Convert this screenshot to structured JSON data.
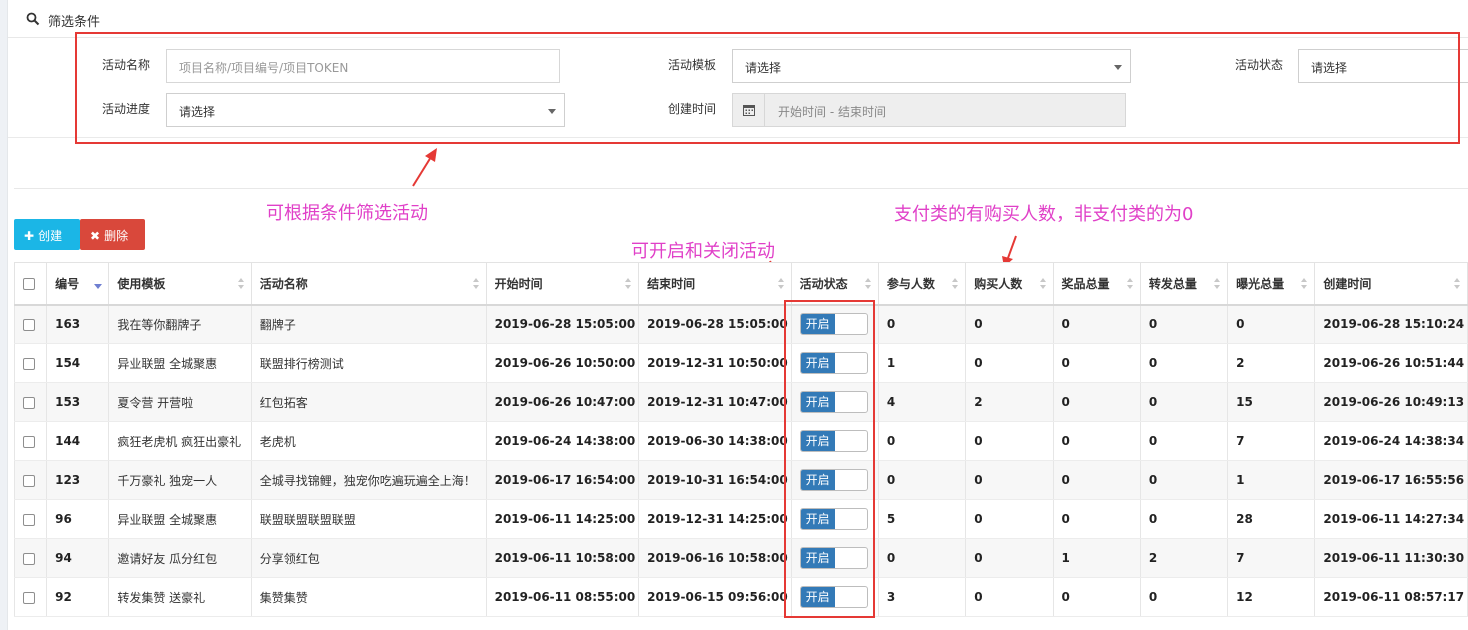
{
  "filter": {
    "title": "筛选条件",
    "name_label": "活动名称",
    "name_placeholder": "项目名称/项目编号/项目TOKEN",
    "template_label": "活动模板",
    "template_value": "请选择",
    "status_label": "活动状态",
    "status_value": "请选择",
    "progress_label": "活动进度",
    "progress_value": "请选择",
    "created_label": "创建时间",
    "created_placeholder": "开始时间 - 结束时间"
  },
  "annotations": {
    "filter_note": "可根据条件筛选活动",
    "toggle_note": "可开启和关闭活动",
    "buyers_note": "支付类的有购买人数，非支付类的为0"
  },
  "toolbar": {
    "create_label": "创建",
    "delete_label": "删除"
  },
  "table": {
    "columns": [
      "编号",
      "使用模板",
      "活动名称",
      "开始时间",
      "结束时间",
      "活动状态",
      "参与人数",
      "购买人数",
      "奖品总量",
      "转发总量",
      "曝光总量",
      "创建时间"
    ],
    "rows": [
      {
        "id": "163",
        "template": "我在等你翻牌子",
        "name": "翻牌子",
        "start": "2019-06-28 15:05:00",
        "end": "2019-06-28 15:05:00",
        "status": "开启",
        "participants": "0",
        "buyers": "0",
        "prizes": "0",
        "shares": "0",
        "exposure": "0",
        "created": "2019-06-28 15:10:24"
      },
      {
        "id": "154",
        "template": "异业联盟 全城聚惠",
        "name": "联盟排行榜测试",
        "start": "2019-06-26 10:50:00",
        "end": "2019-12-31 10:50:00",
        "status": "开启",
        "participants": "1",
        "buyers": "0",
        "prizes": "0",
        "shares": "0",
        "exposure": "2",
        "created": "2019-06-26 10:51:44"
      },
      {
        "id": "153",
        "template": "夏令营 开营啦",
        "name": "红包拓客",
        "start": "2019-06-26 10:47:00",
        "end": "2019-12-31 10:47:00",
        "status": "开启",
        "participants": "4",
        "buyers": "2",
        "prizes": "0",
        "shares": "0",
        "exposure": "15",
        "created": "2019-06-26 10:49:13"
      },
      {
        "id": "144",
        "template": "疯狂老虎机 疯狂出豪礼",
        "name": "老虎机",
        "start": "2019-06-24 14:38:00",
        "end": "2019-06-30 14:38:00",
        "status": "开启",
        "participants": "0",
        "buyers": "0",
        "prizes": "0",
        "shares": "0",
        "exposure": "7",
        "created": "2019-06-24 14:38:34"
      },
      {
        "id": "123",
        "template": "千万豪礼 独宠一人",
        "name": "全城寻找锦鲤，独宠你吃遍玩遍全上海！",
        "start": "2019-06-17 16:54:00",
        "end": "2019-10-31 16:54:00",
        "status": "开启",
        "participants": "0",
        "buyers": "0",
        "prizes": "0",
        "shares": "0",
        "exposure": "1",
        "created": "2019-06-17 16:55:56"
      },
      {
        "id": "96",
        "template": "异业联盟 全城聚惠",
        "name": "联盟联盟联盟联盟",
        "start": "2019-06-11 14:25:00",
        "end": "2019-12-31 14:25:00",
        "status": "开启",
        "participants": "5",
        "buyers": "0",
        "prizes": "0",
        "shares": "0",
        "exposure": "28",
        "created": "2019-06-11 14:27:34"
      },
      {
        "id": "94",
        "template": "邀请好友 瓜分红包",
        "name": "分享领红包",
        "start": "2019-06-11 10:58:00",
        "end": "2019-06-16 10:58:00",
        "status": "开启",
        "participants": "0",
        "buyers": "0",
        "prizes": "1",
        "shares": "2",
        "exposure": "7",
        "created": "2019-06-11 11:30:30"
      },
      {
        "id": "92",
        "template": "转发集赞 送豪礼",
        "name": "集赞集赞",
        "start": "2019-06-11 08:55:00",
        "end": "2019-06-15 09:56:00",
        "status": "开启",
        "participants": "3",
        "buyers": "0",
        "prizes": "0",
        "shares": "0",
        "exposure": "12",
        "created": "2019-06-11 08:57:17"
      }
    ]
  },
  "colors": {
    "annotation": "#e040c8",
    "highlight_box": "#e53935",
    "create_button": "#1bb6e6",
    "delete_button": "#d9483b",
    "toggle_on": "#337ab7"
  }
}
